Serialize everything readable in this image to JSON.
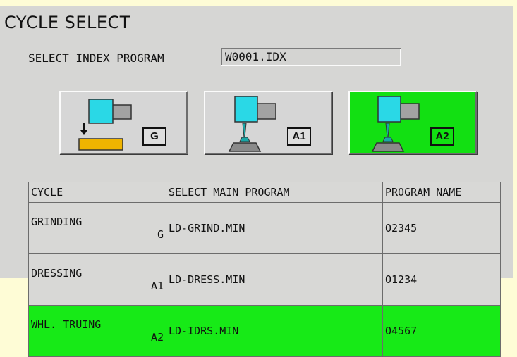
{
  "title": "CYCLE SELECT",
  "index_program": {
    "label": "SELECT INDEX PROGRAM",
    "value": "W0001.IDX"
  },
  "cycle_buttons": [
    {
      "tag": "G",
      "active": false
    },
    {
      "tag": "A1",
      "active": false
    },
    {
      "tag": "A2",
      "active": true
    }
  ],
  "table": {
    "headers": [
      "CYCLE",
      "SELECT MAIN PROGRAM",
      "PROGRAM NAME"
    ],
    "rows": [
      {
        "cycle": "GRINDING",
        "code": "G",
        "main_program": "LD-GRIND.MIN",
        "program_name": "O2345",
        "selected": false
      },
      {
        "cycle": "DRESSING",
        "code": "A1",
        "main_program": "LD-DRESS.MIN",
        "program_name": "O1234",
        "selected": false
      },
      {
        "cycle": "WHL. TRUING",
        "code": "A2",
        "main_program": "LD-IDRS.MIN",
        "program_name": "O4567",
        "selected": true
      }
    ]
  },
  "colors": {
    "active_green": "#12e012",
    "spindle_cyan": "#2ad8e6",
    "workpiece_yellow": "#f0b400",
    "panel_gray": "#d6d6d4",
    "background_yellow": "#fefcd6"
  }
}
